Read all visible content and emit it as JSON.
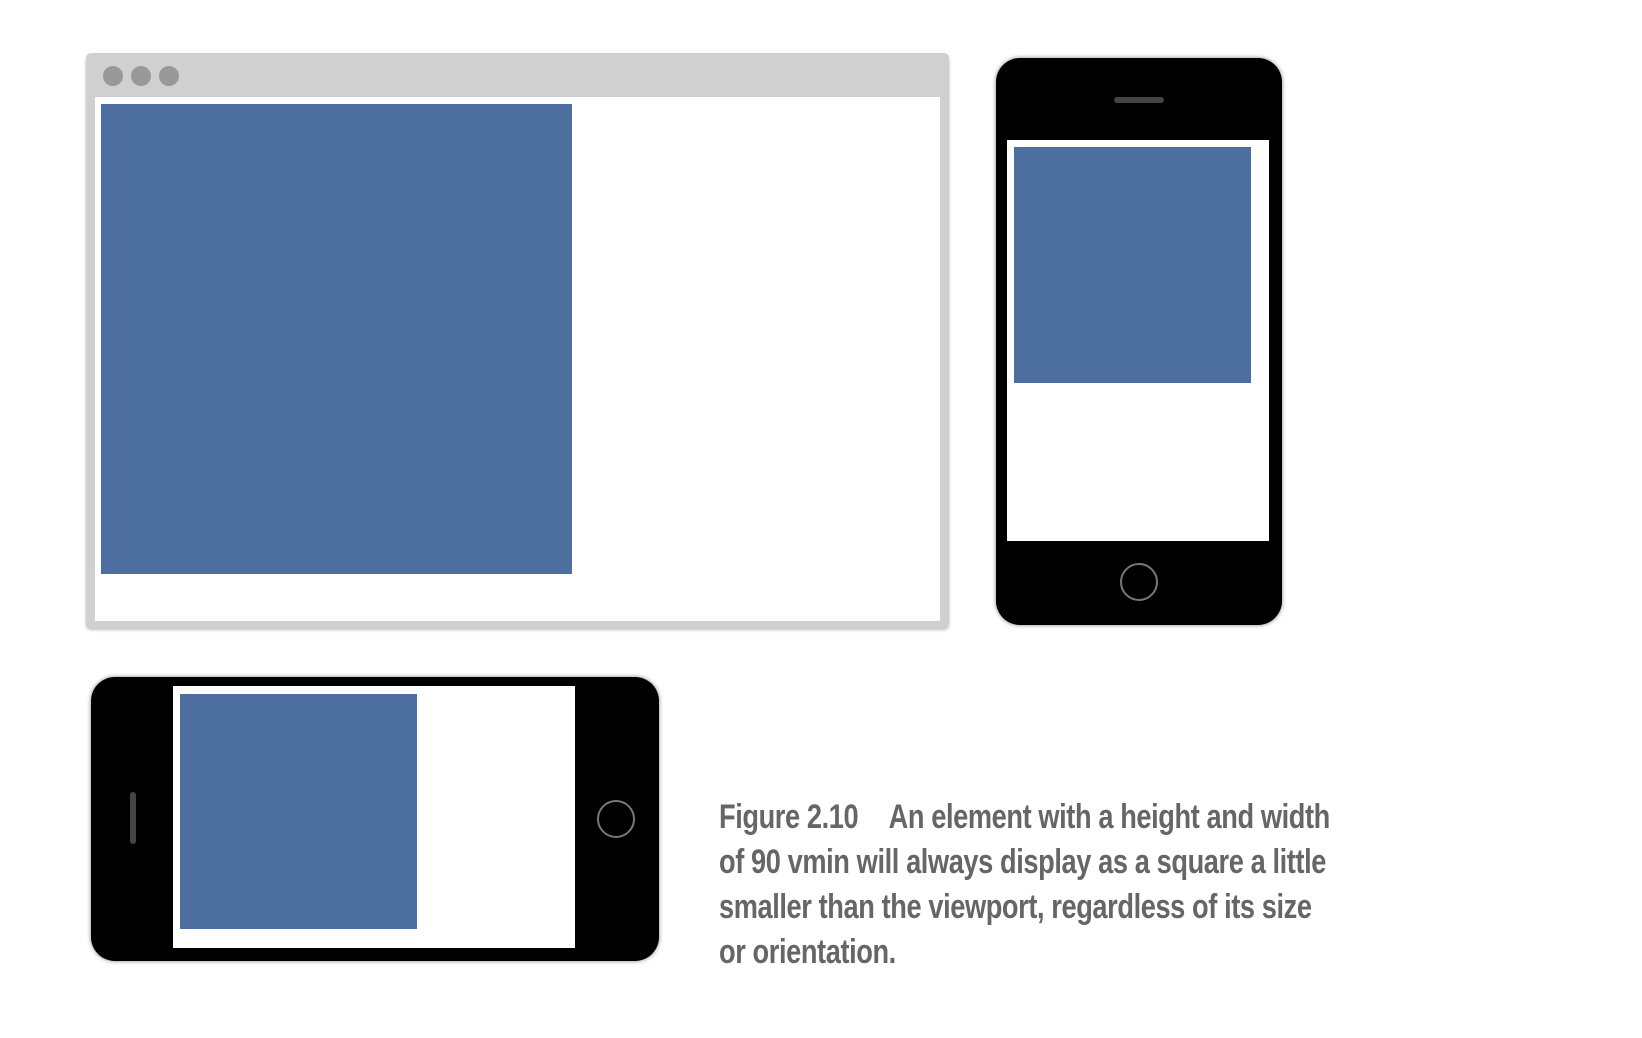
{
  "figure": {
    "label": "Figure 2.10",
    "caption_lines": [
      "An element with a height and width",
      "of 90 vmin will always display as a square a little",
      "smaller than the viewport, regardless of its size",
      "or orientation."
    ]
  },
  "colors": {
    "square": "#4c6f9f",
    "browser_chrome": "#d0d0d0",
    "device_body": "#000000",
    "caption_text": "#666666"
  },
  "square_size": "90 vmin"
}
